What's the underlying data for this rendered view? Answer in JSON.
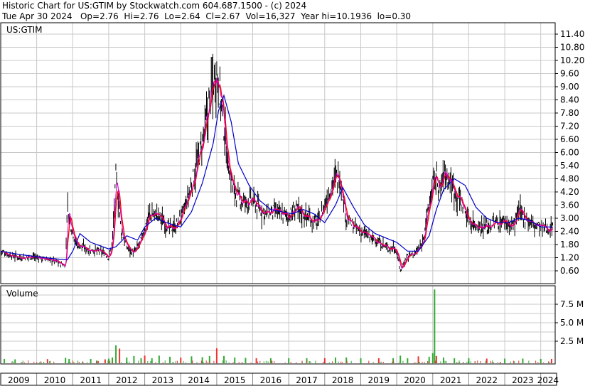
{
  "header": {
    "line1": "Historic Chart for US:GTIM by Stockwatch.com 604.687.1500 - (c) 2024",
    "line2": "Tue Apr 30 2024   Op=2.76  Hi=2.76  Lo=2.64  Cl=2.67  Vol=16,327  Year hi=10.1936  lo=0.30"
  },
  "colors": {
    "price_bars": "#000000",
    "short_ma": "#ff0000",
    "short_ma2": "#cc00cc",
    "long_ma": "#0000cc",
    "volume_bar": "#33aa33",
    "volume_bar_alt": "#ee3333",
    "grid": "#c8c8c8"
  },
  "chart_data": [
    {
      "type": "line",
      "title": "US:GTIM",
      "ylim": [
        0.2,
        11.8
      ],
      "yticks": [
        "11.40",
        "10.80",
        "10.20",
        "9.60",
        "9.00",
        "8.40",
        "7.80",
        "7.20",
        "6.60",
        "6.00",
        "5.40",
        "4.80",
        "4.20",
        "3.60",
        "3.00",
        "2.40",
        "1.80",
        "1.20",
        "0.60"
      ],
      "x_categories": [
        "2009",
        "2010",
        "2011",
        "2012",
        "2013",
        "2014",
        "2015",
        "2016",
        "2017",
        "2018",
        "2019",
        "2020",
        "2021",
        "2022",
        "2023",
        "2024"
      ],
      "grid": true,
      "series": [
        {
          "style": "ohlc-bars",
          "x": [
            2009.0,
            2009.3,
            2009.6,
            2009.9,
            2010.2,
            2010.5,
            2010.7,
            2010.8,
            2010.85,
            2010.9,
            2011.1,
            2011.4,
            2011.7,
            2011.9,
            2012.0,
            2012.1,
            2012.2,
            2012.35,
            2012.5,
            2012.7,
            2012.9,
            2013.1,
            2013.3,
            2013.5,
            2013.7,
            2013.9,
            2014.1,
            2014.3,
            2014.5,
            2014.6,
            2014.75,
            2014.85,
            2014.95,
            2015.0,
            2015.1,
            2015.2,
            2015.3,
            2015.45,
            2015.6,
            2015.8,
            2016.0,
            2016.2,
            2016.4,
            2016.6,
            2016.8,
            2017.0,
            2017.2,
            2017.4,
            2017.6,
            2017.8,
            2018.0,
            2018.2,
            2018.4,
            2018.6,
            2018.8,
            2019.0,
            2019.2,
            2019.4,
            2019.6,
            2019.8,
            2019.9,
            2020.0,
            2020.1,
            2020.2,
            2020.3,
            2020.5,
            2020.7,
            2020.8,
            2020.9,
            2021.0,
            2021.1,
            2021.2,
            2021.3,
            2021.4,
            2021.5,
            2021.6,
            2021.8,
            2022.0,
            2022.2,
            2022.4,
            2022.6,
            2022.8,
            2023.0,
            2023.2,
            2023.4,
            2023.6,
            2023.8,
            2024.0,
            2024.2,
            2024.33
          ],
          "values": [
            1.5,
            1.3,
            1.2,
            1.25,
            1.15,
            1.05,
            0.9,
            0.8,
            3.8,
            3.0,
            1.8,
            1.6,
            1.5,
            1.4,
            1.2,
            1.9,
            4.9,
            2.4,
            1.7,
            1.4,
            2.0,
            3.1,
            3.2,
            2.9,
            2.5,
            2.7,
            3.4,
            4.5,
            5.8,
            6.4,
            7.8,
            8.8,
            9.6,
            9.8,
            8.6,
            7.2,
            5.6,
            4.4,
            3.9,
            3.7,
            3.8,
            3.4,
            3.2,
            3.3,
            3.2,
            3.1,
            3.4,
            3.2,
            3.0,
            2.8,
            3.6,
            4.6,
            5.0,
            3.0,
            2.6,
            2.4,
            2.2,
            2.0,
            1.8,
            1.6,
            1.7,
            1.5,
            0.6,
            1.0,
            1.3,
            1.4,
            1.8,
            2.8,
            3.6,
            4.6,
            4.9,
            4.2,
            5.1,
            4.9,
            4.7,
            4.3,
            3.7,
            2.9,
            2.7,
            2.6,
            2.7,
            2.8,
            2.9,
            2.6,
            3.3,
            3.0,
            2.7,
            2.6,
            2.5,
            2.67
          ]
        },
        {
          "style": "moving-average-long",
          "x": [
            2009.0,
            2009.5,
            2010.0,
            2010.5,
            2010.85,
            2011.0,
            2011.2,
            2011.5,
            2012.0,
            2012.2,
            2012.5,
            2012.8,
            2013.0,
            2013.3,
            2013.6,
            2014.0,
            2014.3,
            2014.6,
            2014.9,
            2015.05,
            2015.2,
            2015.4,
            2015.6,
            2015.9,
            2016.2,
            2016.5,
            2016.8,
            2017.1,
            2017.4,
            2017.7,
            2018.0,
            2018.3,
            2018.5,
            2018.8,
            2019.1,
            2019.4,
            2019.7,
            2020.0,
            2020.3,
            2020.6,
            2020.9,
            2021.1,
            2021.3,
            2021.6,
            2021.9,
            2022.2,
            2022.5,
            2022.8,
            2023.1,
            2023.4,
            2023.7,
            2024.0,
            2024.33
          ],
          "values": [
            1.5,
            1.35,
            1.25,
            1.15,
            1.1,
            1.5,
            2.3,
            1.9,
            1.6,
            1.7,
            2.2,
            2.0,
            2.6,
            3.0,
            2.8,
            2.6,
            3.3,
            4.6,
            6.4,
            7.9,
            8.6,
            7.4,
            5.5,
            4.5,
            3.8,
            3.4,
            3.3,
            3.2,
            3.4,
            3.2,
            2.8,
            3.6,
            4.4,
            3.5,
            2.7,
            2.3,
            2.1,
            1.9,
            1.5,
            1.5,
            2.2,
            3.4,
            4.3,
            4.8,
            4.5,
            3.5,
            3.0,
            2.8,
            2.8,
            3.0,
            2.9,
            2.6,
            2.6
          ]
        }
      ]
    },
    {
      "type": "bar",
      "title": "Volume",
      "yticks": [
        "7.5 M",
        "5.0 M",
        "2.5 M"
      ],
      "ylim": [
        0,
        9.6
      ],
      "x": [
        2009.1,
        2009.4,
        2010.3,
        2010.8,
        2010.9,
        2011.5,
        2011.9,
        2012.0,
        2012.1,
        2012.2,
        2012.3,
        2012.5,
        2012.7,
        2012.9,
        2013.0,
        2013.2,
        2013.4,
        2013.7,
        2014.0,
        2014.3,
        2014.6,
        2014.8,
        2015.0,
        2015.2,
        2015.5,
        2015.8,
        2016.1,
        2016.5,
        2017.0,
        2017.5,
        2018.0,
        2018.3,
        2018.6,
        2019.0,
        2019.5,
        2019.9,
        2020.1,
        2020.3,
        2020.6,
        2020.9,
        2021.0,
        2021.05,
        2021.1,
        2021.3,
        2021.6,
        2022.0,
        2022.5,
        2023.0,
        2023.5,
        2024.0,
        2024.3
      ],
      "values": [
        0.1,
        0.05,
        0.08,
        0.25,
        0.1,
        0.1,
        0.05,
        0.15,
        0.3,
        1.95,
        1.5,
        0.3,
        0.5,
        0.2,
        0.55,
        0.2,
        0.55,
        0.4,
        0.3,
        0.45,
        0.35,
        0.5,
        1.55,
        0.5,
        0.3,
        0.25,
        0.2,
        0.2,
        0.2,
        0.2,
        0.2,
        0.3,
        0.3,
        0.2,
        0.2,
        0.2,
        0.55,
        0.2,
        0.45,
        0.4,
        0.9,
        9.5,
        0.5,
        0.3,
        0.2,
        0.2,
        0.15,
        0.15,
        0.15,
        0.1,
        0.1
      ]
    }
  ]
}
